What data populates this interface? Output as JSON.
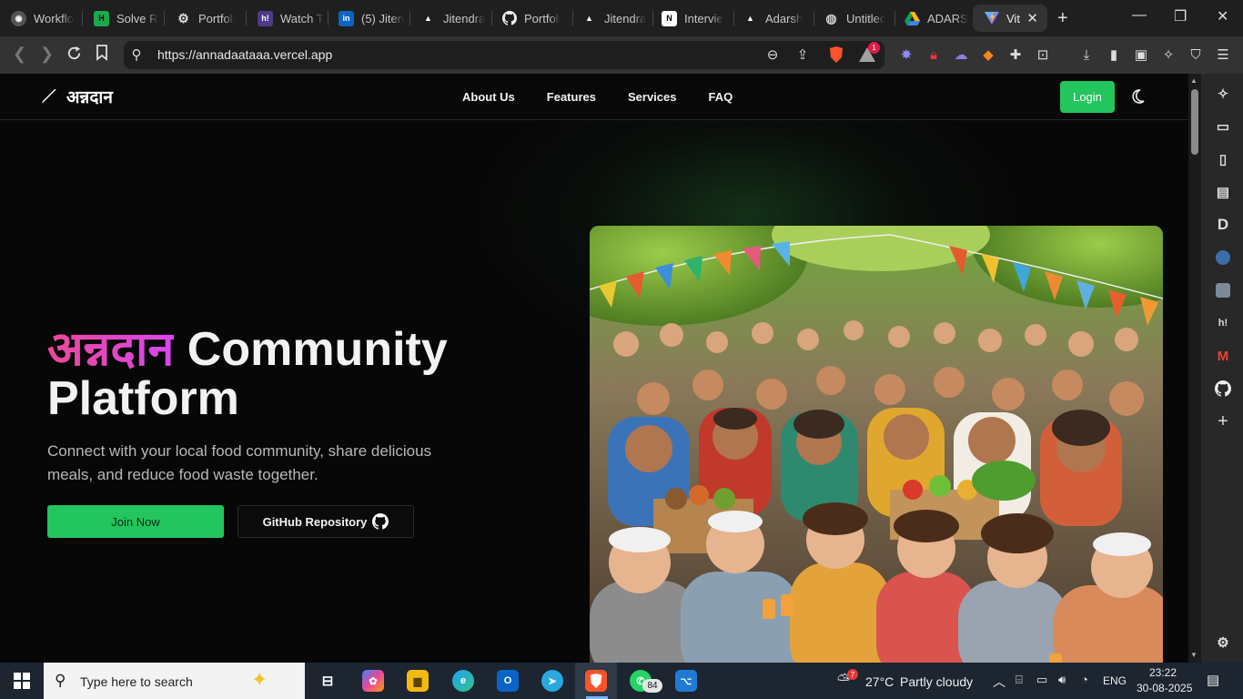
{
  "browser": {
    "tabs": [
      {
        "title": "Workflo",
        "icon": "app-icon"
      },
      {
        "title": "Solve R",
        "icon": "hackerrank-icon"
      },
      {
        "title": "Portfoli",
        "icon": "openai-icon"
      },
      {
        "title": "Watch T",
        "icon": "hashnode-icon"
      },
      {
        "title": "(5) Jiten",
        "icon": "linkedin-icon"
      },
      {
        "title": "Jitendra",
        "icon": "vercel-icon"
      },
      {
        "title": "Portfoli",
        "icon": "github-icon"
      },
      {
        "title": "Jitendra",
        "icon": "vercel-icon"
      },
      {
        "title": "Intervie",
        "icon": "notion-icon"
      },
      {
        "title": "Adarsh",
        "icon": "vercel-icon"
      },
      {
        "title": "Untitlec",
        "icon": "globe-icon"
      },
      {
        "title": "ADARS",
        "icon": "drive-icon"
      },
      {
        "title": "Vit",
        "icon": "vite-icon"
      }
    ],
    "url": "https://annadaataaa.vercel.app",
    "shield_badge": "1"
  },
  "site": {
    "brand": "अन्नदान",
    "nav": [
      "About Us",
      "Features",
      "Services",
      "FAQ"
    ],
    "login": "Login",
    "hero": {
      "title_accent": "अन्नदान",
      "title_rest": " Community Platform",
      "subtitle": "Connect with your local food community, share delicious meals, and reduce food waste together.",
      "join": "Join Now",
      "github": "GitHub Repository"
    }
  },
  "taskbar": {
    "search_placeholder": "Type here to search",
    "whatsapp_badge": "84",
    "weather_badge": "7",
    "temperature": "27°C",
    "weather": "Partly cloudy",
    "lang": "ENG",
    "time": "23:22",
    "date": "30-08-2025"
  },
  "colors": {
    "accent_green": "#22c55e",
    "accent_pink": "#ec4899"
  }
}
